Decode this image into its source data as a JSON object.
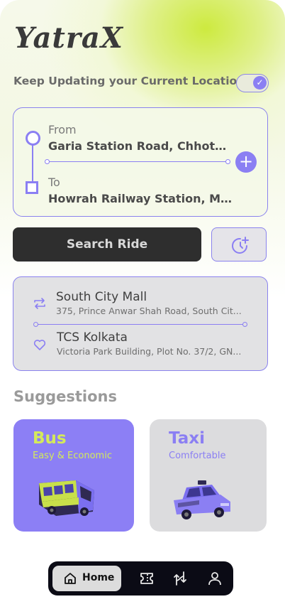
{
  "app": {
    "logo": "YatraX"
  },
  "location_toggle": {
    "label": "Keep Updating your Current Location",
    "enabled": true
  },
  "route": {
    "from_label": "From",
    "from_value": "Garia Station Road, Chhoto...",
    "to_label": "To",
    "to_value": "Howrah Railway Station, M..."
  },
  "actions": {
    "search_label": "Search Ride"
  },
  "saved_places": [
    {
      "name": "South City Mall",
      "address": "375, Prince Anwar Shah Road, South Cit...",
      "icon": "swap-icon"
    },
    {
      "name": "TCS Kolkata",
      "address": "Victoria Park Building, Plot No. 37/2, GN...",
      "icon": "heart-icon"
    }
  ],
  "suggestions": {
    "title": "Suggestions",
    "items": [
      {
        "title": "Bus",
        "subtitle": "Easy & Economic"
      },
      {
        "title": "Taxi",
        "subtitle": "Comfortable"
      }
    ]
  },
  "nav": {
    "home_label": "Home",
    "items": [
      "home-icon",
      "ticket-icon",
      "routes-icon",
      "profile-icon"
    ]
  },
  "colors": {
    "accent": "#8b7ff3",
    "lime": "#d4ea5a",
    "dark": "#2e2e2e"
  }
}
